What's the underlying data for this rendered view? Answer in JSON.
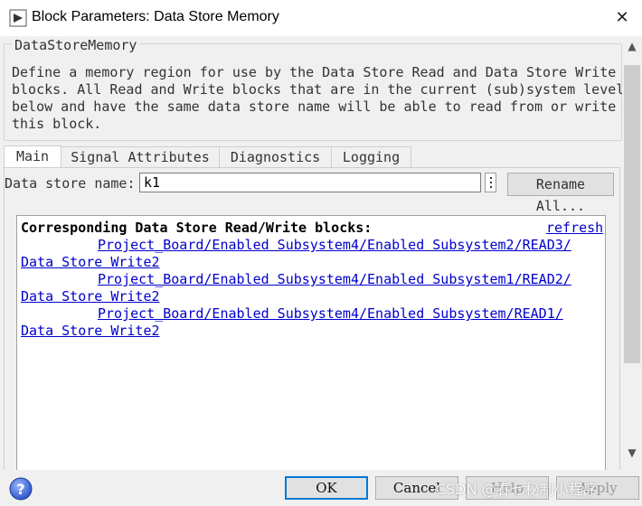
{
  "window": {
    "title": "Block Parameters: Data Store Memory",
    "close_symbol": "✕"
  },
  "description": {
    "group_title": "DataStoreMemory",
    "text": "Define a memory region for use by the Data Store Read and Data Store Write\nblocks. All Read and Write blocks that are in the current (sub)system level or\nbelow and have the same data store name will be able to read from or write to\nthis block."
  },
  "tabs": [
    {
      "label": "Main",
      "active": true
    },
    {
      "label": "Signal Attributes",
      "active": false
    },
    {
      "label": "Diagnostics",
      "active": false
    },
    {
      "label": "Logging",
      "active": false
    }
  ],
  "main": {
    "name_label": "Data store name:",
    "name_value": "k1",
    "rename_button": "Rename All...",
    "blocks_heading": "Corresponding Data Store Read/Write blocks:",
    "refresh_link": "refresh",
    "blocks": [
      {
        "read_path": "Project_Board/Enabled Subsystem4/Enabled Subsystem2/READ3/",
        "write_path": "Data Store Write2"
      },
      {
        "read_path": "Project_Board/Enabled Subsystem4/Enabled Subsystem1/READ2/",
        "write_path": "Data Store Write2"
      },
      {
        "read_path": "Project_Board/Enabled Subsystem4/Enabled Subsystem/READ1/",
        "write_path": "Data Store Write2"
      }
    ]
  },
  "footer": {
    "ok": "OK",
    "cancel": "Cancel",
    "help": "Help",
    "apply": "Apply"
  },
  "watermark": "CSDN @春七秘制小程序",
  "colors": {
    "link": "#0000cc",
    "accent": "#0078d7",
    "panel": "#f0f0f0"
  }
}
